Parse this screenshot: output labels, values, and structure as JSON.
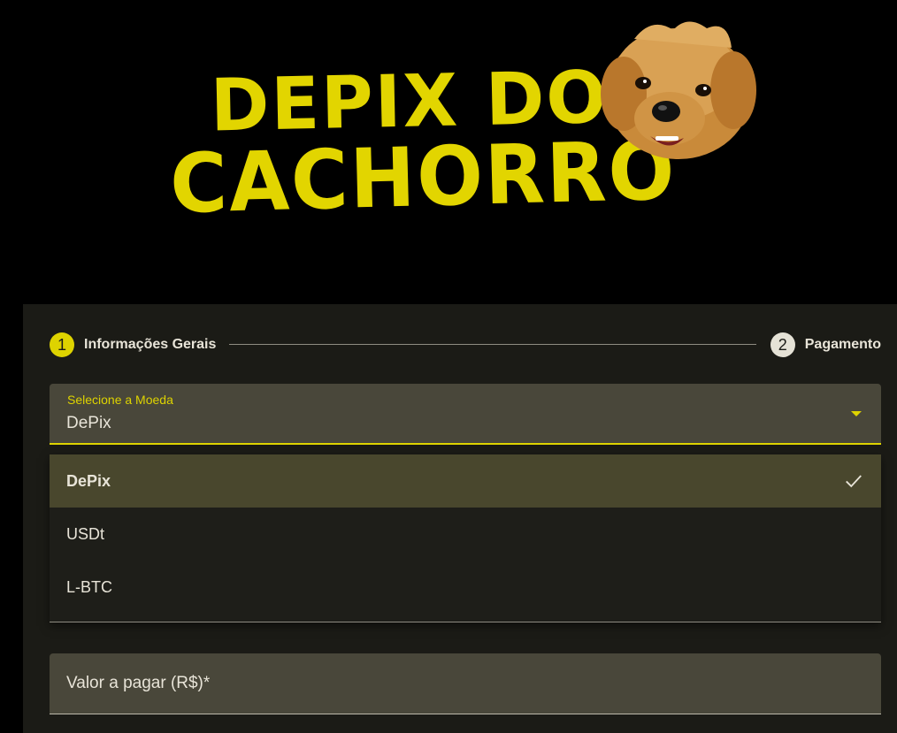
{
  "logo": {
    "line1": "DEPIX DO",
    "line2": "CACHORRO",
    "icon": "dog-face-icon",
    "color": "#e2d500"
  },
  "stepper": {
    "steps": [
      {
        "number": "1",
        "label": "Informações Gerais",
        "active": true
      },
      {
        "number": "2",
        "label": "Pagamento",
        "active": false
      }
    ]
  },
  "currency_select": {
    "label": "Selecione a Moeda",
    "value": "DePix",
    "options": [
      {
        "label": "DePix",
        "selected": true
      },
      {
        "label": "USDt",
        "selected": false
      },
      {
        "label": "L-BTC",
        "selected": false
      }
    ]
  },
  "amount_field": {
    "label": "Valor a pagar (R$)*"
  },
  "colors": {
    "accent": "#ded300",
    "background": "#000000",
    "card": "#1b1b16",
    "field": "#49473a",
    "selected_option": "#49472d",
    "text": "#e8e4d8"
  }
}
